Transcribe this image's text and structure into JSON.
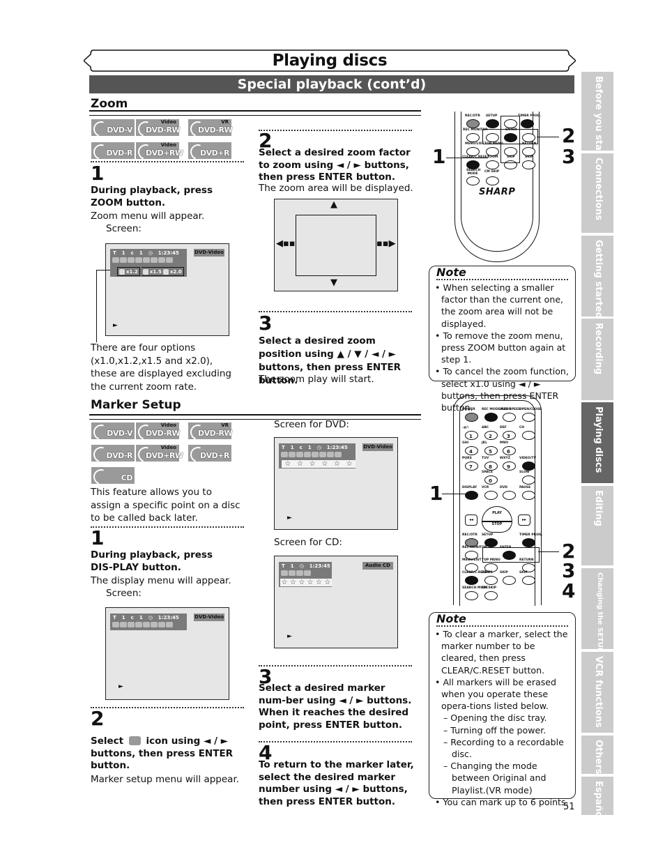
{
  "header": {
    "title": "Playing discs",
    "subtitle": "Special playback (cont’d)"
  },
  "zoom": {
    "section_title": "Zoom",
    "discs": [
      {
        "label": "DVD-V",
        "sup": ""
      },
      {
        "label": "DVD-RW",
        "sup": "Video"
      },
      {
        "label": "DVD-RW",
        "sup": "VR"
      },
      {
        "label": "DVD-R",
        "sup": ""
      },
      {
        "label": "DVD+RW",
        "sup": "Video"
      },
      {
        "label": "DVD+R",
        "sup": ""
      }
    ],
    "step1": {
      "num": "1",
      "bold": "During playback, press ZOOM button.",
      "text": "Zoom menu will appear.",
      "screen_label": "Screen:",
      "osd": {
        "title_icon": "T",
        "title_num": "1",
        "chapter_icon": "c",
        "chapter_num": "1",
        "time": "1:23:45",
        "disc_tag": "DVD-Video",
        "options": [
          "x1.2",
          "x1.5",
          "x2.0"
        ],
        "play_indicator": "►"
      },
      "caption": "There are four options (x1.0,x1.2,x1.5 and x2.0), these are displayed excluding the current zoom rate."
    },
    "step2": {
      "num": "2",
      "bold": "Select a desired zoom factor to zoom using ◄ / ► buttons, then press ENTER button.",
      "text": "The zoom area will be displayed."
    },
    "step3": {
      "num": "3",
      "bold": "Select a desired zoom position using ▲ / ▼ / ◄ / ► buttons, then press ENTER button.",
      "text": "The zoom play will start."
    },
    "note": {
      "title": "Note",
      "items": [
        "When selecting a smaller factor than the current one, the zoom area will not be displayed.",
        "To remove the zoom menu, press ZOOM button again at step 1.",
        "To cancel the zoom function, select x1.0 using ◄ / ► buttons, then press ENTER button."
      ]
    },
    "remote": {
      "brand": "SHARP",
      "labels": [
        "REC/OTR",
        "SETUP",
        "TIMER PROG.",
        "REC MONITOR",
        "ENTER",
        "MENU/LIST",
        "TOP MENU",
        "RETURN",
        "CLEAR/C.RESET",
        "ZOOM",
        "SKIP",
        "SKIP",
        "SEARCH MODE",
        "CM SKIP"
      ],
      "callouts": [
        "1",
        "2",
        "3"
      ]
    }
  },
  "marker": {
    "section_title": "Marker Setup",
    "discs": [
      {
        "label": "DVD-V",
        "sup": ""
      },
      {
        "label": "DVD-RW",
        "sup": "Video"
      },
      {
        "label": "DVD-RW",
        "sup": "VR"
      },
      {
        "label": "DVD-R",
        "sup": ""
      },
      {
        "label": "DVD+RW",
        "sup": "Video"
      },
      {
        "label": "DVD+R",
        "sup": ""
      },
      {
        "label": "CD",
        "sup": ""
      }
    ],
    "intro": "This feature allows you to assign a specific point on a disc to be called back later.",
    "step1": {
      "num": "1",
      "bold": "During playback, press DIS-PLAY button.",
      "text": "The display menu will appear.",
      "screen_label": "Screen:",
      "osd": {
        "title_icon": "T",
        "title_num": "1",
        "chapter_icon": "c",
        "chapter_num": "1",
        "time": "1:23:45",
        "disc_tag": "DVD-Video",
        "play_indicator": "►"
      }
    },
    "step2": {
      "num": "2",
      "bold_pre": "Select",
      "bold_post": "icon using ◄ / ► buttons, then press ENTER button.",
      "text": "Marker setup menu will appear."
    },
    "screen_dvd": {
      "label": "Screen for DVD:",
      "osd": {
        "title_icon": "T",
        "title_num": "1",
        "chapter_icon": "c",
        "chapter_num": "1",
        "time": "1:23:45",
        "disc_tag": "DVD-Video",
        "markers": [
          "☆",
          "☆",
          "☆",
          "☆",
          "☆",
          "☆"
        ],
        "play_indicator": "►"
      }
    },
    "screen_cd": {
      "label": "Screen for CD:",
      "osd": {
        "title_icon": "T",
        "title_num": "1",
        "time": "1:23:45",
        "disc_tag": "Audio CD",
        "markers": [
          "☆",
          "☆",
          "☆",
          "☆",
          "☆",
          "☆"
        ],
        "play_indicator": "►"
      }
    },
    "step3": {
      "num": "3",
      "bold": "Select a desired marker num-ber using ◄ / ► buttons. When it reaches the desired point, press ENTER button."
    },
    "step4": {
      "num": "4",
      "bold": "To return to the marker later, select the desired marker number using ◄ / ► buttons, then press ENTER button."
    },
    "note": {
      "title": "Note",
      "items": [
        {
          "text": "To clear a marker, select the marker number to be cleared, then press CLEAR/C.RESET button.",
          "sub": false
        },
        {
          "text": "All markers will be erased when you operate these opera-tions listed below.",
          "sub": false
        },
        {
          "text": "– Opening the disc tray.",
          "sub": true
        },
        {
          "text": "– Turning off the power.",
          "sub": true
        },
        {
          "text": "– Recording to a recordable disc.",
          "sub": true
        },
        {
          "text": "– Changing the mode between Original and Playlist.(VR mode)",
          "sub": true
        },
        {
          "text": "You can mark up to 6 points.",
          "sub": false
        }
      ]
    },
    "remote": {
      "labels": [
        "POWER",
        "REC MODE REC SPEED",
        "AUDIO",
        "OPEN/CLOSE",
        ".@/:",
        "ABC",
        "DEF",
        "GHI",
        "JKL",
        "MNO",
        "CH",
        "PQRS",
        "TUV",
        "WXYZ",
        "VIDEO/TV",
        "SPACE",
        "SLOW",
        "DISPLAY",
        "VCR",
        "DVD",
        "PAUSE",
        "PLAY",
        "STOP",
        "REC/OTR",
        "SETUP",
        "TIMER PROG.",
        "REC MONITOR",
        "ENTER",
        "MENU/LIST",
        "TOP MENU",
        "RETURN",
        "CLEAR/C.RESET",
        "ZOOM",
        "SKIP",
        "SKIP",
        "SEARCH MODE",
        "CM SKIP"
      ],
      "digits": [
        "1",
        "2",
        "3",
        "4",
        "5",
        "6",
        "7",
        "8",
        "9",
        "0"
      ],
      "callouts": [
        "1",
        "2",
        "3",
        "4"
      ]
    }
  },
  "side_tabs": [
    {
      "label": "Before you start",
      "active": false
    },
    {
      "label": "Connections",
      "active": false
    },
    {
      "label": "Getting started",
      "active": false
    },
    {
      "label": "Recording",
      "active": false
    },
    {
      "label": "Playing discs",
      "active": true
    },
    {
      "label": "Editing",
      "active": false
    },
    {
      "label": "Changing the SETUP menu",
      "active": false
    },
    {
      "label": "VCR functions",
      "active": false
    },
    {
      "label": "Others",
      "active": false
    },
    {
      "label": "Español",
      "active": false
    }
  ],
  "page_number": "51"
}
